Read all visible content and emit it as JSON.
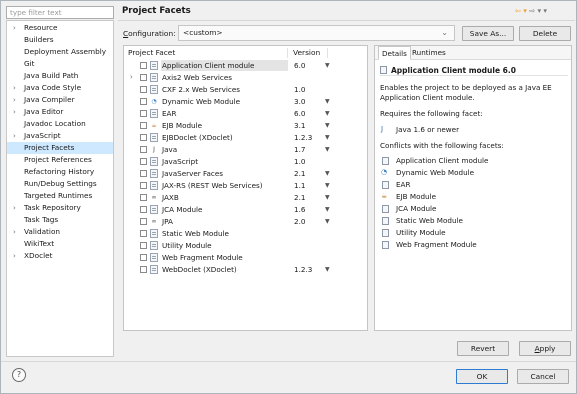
{
  "filter": {
    "placeholder": "type filter text"
  },
  "nav": {
    "items": [
      {
        "label": "Resource",
        "expandable": true
      },
      {
        "label": "Builders",
        "expandable": false
      },
      {
        "label": "Deployment Assembly",
        "expandable": false
      },
      {
        "label": "Git",
        "expandable": false
      },
      {
        "label": "Java Build Path",
        "expandable": false
      },
      {
        "label": "Java Code Style",
        "expandable": true
      },
      {
        "label": "Java Compiler",
        "expandable": true
      },
      {
        "label": "Java Editor",
        "expandable": true
      },
      {
        "label": "Javadoc Location",
        "expandable": false
      },
      {
        "label": "JavaScript",
        "expandable": true
      },
      {
        "label": "Project Facets",
        "expandable": false,
        "selected": true
      },
      {
        "label": "Project References",
        "expandable": false
      },
      {
        "label": "Refactoring History",
        "expandable": false
      },
      {
        "label": "Run/Debug Settings",
        "expandable": false
      },
      {
        "label": "Targeted Runtimes",
        "expandable": false
      },
      {
        "label": "Task Repository",
        "expandable": true
      },
      {
        "label": "Task Tags",
        "expandable": false
      },
      {
        "label": "Validation",
        "expandable": true
      },
      {
        "label": "WikiText",
        "expandable": false
      },
      {
        "label": "XDoclet",
        "expandable": true
      }
    ]
  },
  "header": {
    "title": "Project Facets",
    "back_icon": "⇦ ▾",
    "forward_icon": "⇨ ▾ ▾"
  },
  "config": {
    "label_prefix": "C",
    "label_rest": "onfiguration:",
    "value": "<custom>",
    "save_as": "Save As...",
    "delete": "Delete"
  },
  "facets": {
    "col_facet": "Project Facet",
    "col_version": "Version",
    "rows": [
      {
        "name": "Application Client module",
        "version": "6.0",
        "dropdown": true,
        "icon": "page",
        "selected": true,
        "expand": false
      },
      {
        "name": "Axis2 Web Services",
        "version": "",
        "dropdown": false,
        "icon": "page",
        "selected": false,
        "expand": true
      },
      {
        "name": "CXF 2.x Web Services",
        "version": "1.0",
        "dropdown": false,
        "icon": "page",
        "selected": false,
        "expand": false
      },
      {
        "name": "Dynamic Web Module",
        "version": "3.0",
        "dropdown": true,
        "icon": "globe",
        "selected": false,
        "expand": false
      },
      {
        "name": "EAR",
        "version": "6.0",
        "dropdown": true,
        "icon": "page",
        "selected": false,
        "expand": false
      },
      {
        "name": "EJB Module",
        "version": "3.1",
        "dropdown": true,
        "icon": "bean",
        "selected": false,
        "expand": false
      },
      {
        "name": "EJBDoclet (XDoclet)",
        "version": "1.2.3",
        "dropdown": true,
        "icon": "page",
        "selected": false,
        "expand": false
      },
      {
        "name": "Java",
        "version": "1.7",
        "dropdown": true,
        "icon": "java",
        "selected": false,
        "expand": false
      },
      {
        "name": "JavaScript",
        "version": "1.0",
        "dropdown": false,
        "icon": "page",
        "selected": false,
        "expand": false
      },
      {
        "name": "JavaServer Faces",
        "version": "2.1",
        "dropdown": true,
        "icon": "page",
        "selected": false,
        "expand": false
      },
      {
        "name": "JAX-RS (REST Web Services)",
        "version": "1.1",
        "dropdown": true,
        "icon": "page",
        "selected": false,
        "expand": false
      },
      {
        "name": "JAXB",
        "version": "2.1",
        "dropdown": true,
        "icon": "link",
        "selected": false,
        "expand": false
      },
      {
        "name": "JCA Module",
        "version": "1.6",
        "dropdown": true,
        "icon": "page",
        "selected": false,
        "expand": false
      },
      {
        "name": "JPA",
        "version": "2.0",
        "dropdown": true,
        "icon": "link",
        "selected": false,
        "expand": false
      },
      {
        "name": "Static Web Module",
        "version": "",
        "dropdown": false,
        "icon": "page",
        "selected": false,
        "expand": false
      },
      {
        "name": "Utility Module",
        "version": "",
        "dropdown": false,
        "icon": "page",
        "selected": false,
        "expand": false
      },
      {
        "name": "Web Fragment Module",
        "version": "",
        "dropdown": false,
        "icon": "page",
        "selected": false,
        "expand": false
      },
      {
        "name": "WebDoclet (XDoclet)",
        "version": "1.2.3",
        "dropdown": true,
        "icon": "page",
        "selected": false,
        "expand": false
      }
    ]
  },
  "details": {
    "tab_details": "Details",
    "tab_runtimes": "Runtimes",
    "title": "Application Client module 6.0",
    "desc_line1": "Enables the project to be deployed as a Java EE",
    "desc_line2": "Application Client module.",
    "requires_label": "Requires the following facet:",
    "requires_item": "Java 1.6 or newer",
    "conflicts_label": "Conflicts with the following facets:",
    "conflicts": [
      "Application Client module",
      "Dynamic Web Module",
      "EAR",
      "EJB Module",
      "JCA Module",
      "Static Web Module",
      "Utility Module",
      "Web Fragment Module"
    ]
  },
  "buttons": {
    "revert": "Revert",
    "apply_prefix": "A",
    "apply_rest": "pply",
    "ok": "OK",
    "cancel": "Cancel",
    "help": "?"
  },
  "colors": {
    "selection": "#cde8ff",
    "accent_border": "#2d7cd1"
  }
}
